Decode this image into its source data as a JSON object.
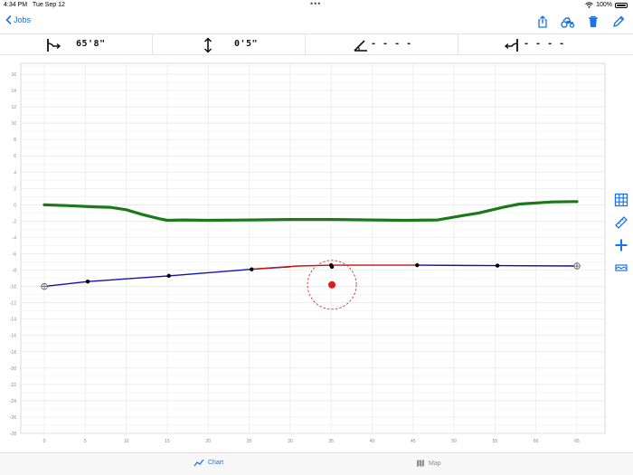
{
  "status": {
    "time": "4:34 PM",
    "date": "Tue Sep 12",
    "battery": "100%"
  },
  "nav": {
    "back_label": "Jobs",
    "accent": "#1a73e8"
  },
  "info": [
    {
      "icon": "span-length-icon",
      "value": "65'8\""
    },
    {
      "icon": "vertical-clearance-icon",
      "value": "0'5\""
    },
    {
      "icon": "angle-icon",
      "value": "- - - -"
    },
    {
      "icon": "end-marker-icon",
      "value": "- - - -"
    }
  ],
  "chart_data": {
    "type": "line",
    "xlim": [
      0,
      65
    ],
    "ylim": [
      -28,
      17
    ],
    "x_ticks": [
      0,
      5,
      10,
      15,
      20,
      25,
      30,
      35,
      40,
      45,
      50,
      55,
      60,
      65
    ],
    "y_ticks": [
      16,
      14,
      12,
      10,
      8,
      6,
      4,
      2,
      0,
      -2,
      -4,
      -6,
      -8,
      -10,
      -12,
      -14,
      -16,
      -18,
      -20,
      -22,
      -24,
      -26,
      -28
    ],
    "grid": true,
    "series": [
      {
        "color": "#1a7a1a",
        "points": [
          [
            0,
            0
          ],
          [
            3,
            -0.1
          ],
          [
            6,
            -0.25
          ],
          [
            8,
            -0.3
          ],
          [
            10,
            -0.6
          ],
          [
            12,
            -1.2
          ],
          [
            14,
            -1.7
          ],
          [
            15,
            -1.9
          ],
          [
            17,
            -1.85
          ],
          [
            20,
            -1.9
          ],
          [
            25,
            -1.85
          ],
          [
            30,
            -1.8
          ],
          [
            35,
            -1.8
          ],
          [
            40,
            -1.85
          ],
          [
            44,
            -1.9
          ],
          [
            48,
            -1.85
          ],
          [
            50,
            -1.5
          ],
          [
            53,
            -1.0
          ],
          [
            56,
            -0.3
          ],
          [
            58,
            0.1
          ],
          [
            62,
            0.35
          ],
          [
            65,
            0.4
          ]
        ]
      },
      {
        "color": "#1010c0",
        "points": [
          [
            0,
            -10
          ],
          [
            5.3,
            -9.4
          ],
          [
            15.2,
            -8.7
          ],
          [
            25.3,
            -7.9
          ],
          [
            30,
            -7.6
          ]
        ]
      },
      {
        "color": "#cc1111",
        "points": [
          [
            25.3,
            -7.9
          ],
          [
            28,
            -7.7
          ],
          [
            31,
            -7.5
          ],
          [
            35,
            -7.4
          ],
          [
            38,
            -7.4
          ],
          [
            41,
            -7.4
          ],
          [
            45.5,
            -7.4
          ]
        ]
      },
      {
        "color": "#1010c0",
        "points": [
          [
            45.5,
            -7.4
          ],
          [
            55.3,
            -7.45
          ],
          [
            65,
            -7.5
          ]
        ]
      }
    ],
    "dots": [
      [
        5.3,
        -9.4
      ],
      [
        15.2,
        -8.7
      ],
      [
        25.3,
        -7.9
      ],
      [
        35,
        -7.4
      ],
      [
        35.1,
        -7.6
      ],
      [
        45.5,
        -7.4
      ],
      [
        55.3,
        -7.45
      ]
    ],
    "end_markers": [
      [
        0,
        -10
      ],
      [
        65,
        -7.5
      ]
    ],
    "selected_point": [
      35.1,
      -9.8
    ]
  },
  "tabs": [
    {
      "label": "Chart",
      "icon": "chart-line-icon",
      "active": true
    },
    {
      "label": "Map",
      "icon": "map-icon",
      "active": false
    }
  ]
}
